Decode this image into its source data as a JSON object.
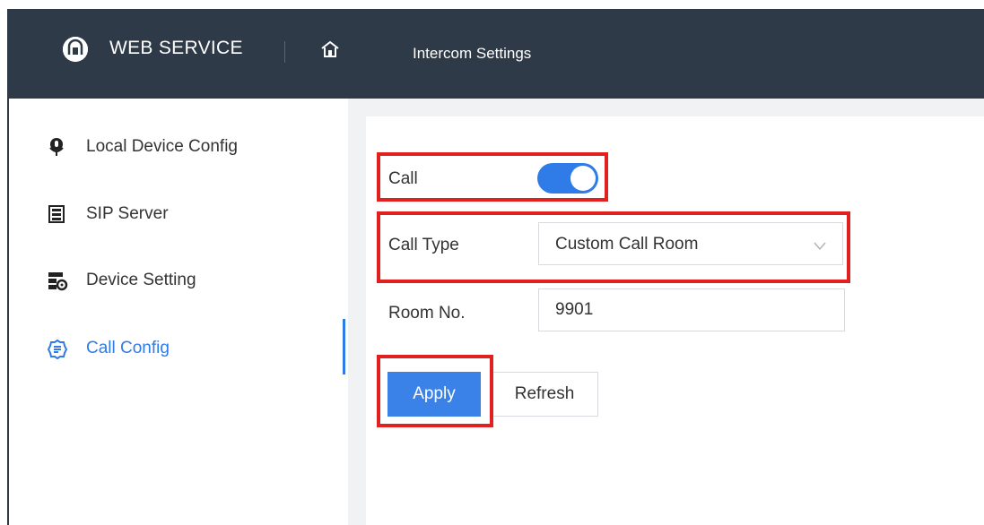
{
  "header": {
    "brand": "WEB SERVICE",
    "title": "Intercom Settings"
  },
  "sidebar": {
    "items": [
      {
        "label": "Local Device Config",
        "icon": "microphone-icon"
      },
      {
        "label": "SIP Server",
        "icon": "server-icon"
      },
      {
        "label": "Device Setting",
        "icon": "device-settings-icon"
      },
      {
        "label": "Call Config",
        "icon": "call-config-icon",
        "active": true
      }
    ]
  },
  "form": {
    "call_label": "Call",
    "call_enabled": true,
    "call_type_label": "Call Type",
    "call_type_value": "Custom Call Room",
    "room_label": "Room No.",
    "room_value": "9901",
    "apply_label": "Apply",
    "refresh_label": "Refresh"
  },
  "colors": {
    "header_bg": "#2f3a48",
    "accent": "#2f7be8",
    "highlight": "#e12020"
  }
}
